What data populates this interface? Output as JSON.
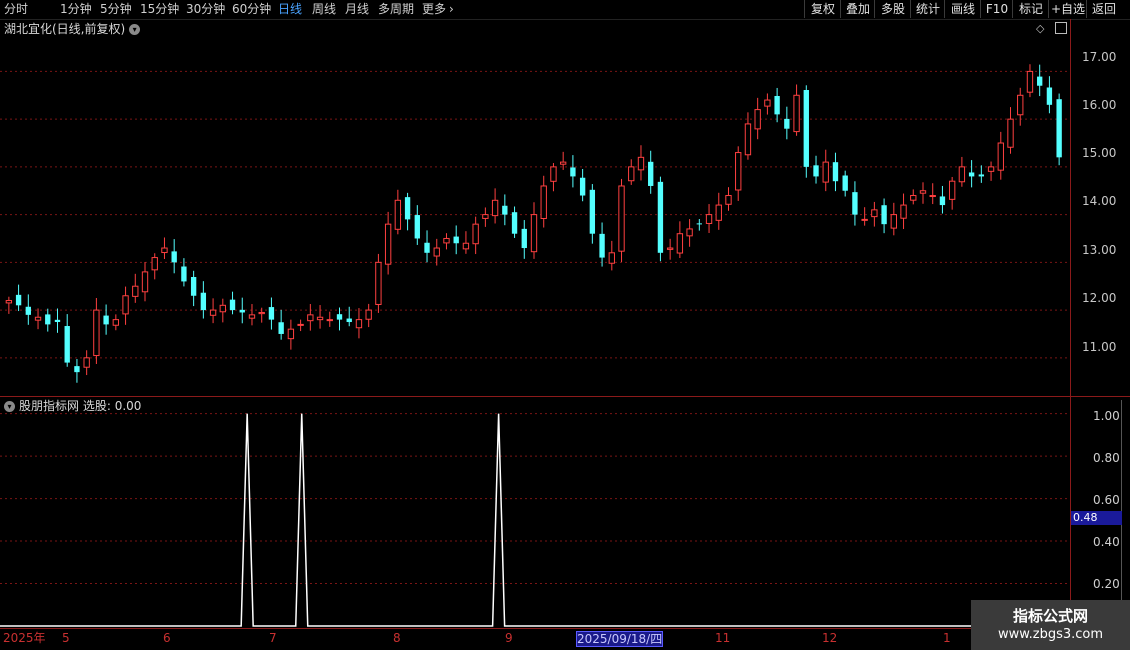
{
  "toolbar": {
    "periods": [
      "分时",
      "1分钟",
      "5分钟",
      "15分钟",
      "30分钟",
      "60分钟",
      "日线",
      "周线",
      "月线",
      "多周期",
      "更多"
    ],
    "active_period": "日线",
    "buttons": [
      "复权",
      "叠加",
      "多股",
      "统计",
      "画线",
      "F10",
      "标记",
      "+自选",
      "返回"
    ]
  },
  "main": {
    "title": "湖北宜化(日线,前复权)",
    "y_ticks": [
      "17.00",
      "16.00",
      "15.00",
      "14.00",
      "13.00",
      "12.00",
      "11.00"
    ]
  },
  "indicator": {
    "title": "股朋指标网",
    "label": "选股: 0.00",
    "y_ticks": [
      "1.00",
      "0.80",
      "0.60",
      "0.40",
      "0.20"
    ],
    "current_value": "0.48"
  },
  "x_axis": {
    "labels": [
      "2025年",
      "5",
      "6",
      "7",
      "8",
      "9",
      "2025/09/18/四",
      "11",
      "12",
      "1"
    ]
  },
  "watermark": {
    "line1": "指标公式网",
    "line2": "www.zbgs3.com"
  },
  "colors": {
    "up": "#ff4040",
    "down": "#54ffff",
    "grid": "#7a1515",
    "line": "#ffffff",
    "active": "#4aa3ff"
  },
  "chart_data": [
    {
      "type": "candlestick",
      "title": "湖北宜化(日线,前复权)",
      "ylim": [
        10.2,
        17.7
      ],
      "y_ticks": [
        11,
        12,
        13,
        14,
        15,
        16,
        17
      ],
      "x_labels": [
        "2025年",
        "5",
        "6",
        "7",
        "8",
        "9",
        "2025/09/18/四",
        "11",
        "12",
        "1"
      ],
      "approx_close_series": [
        12.2,
        12.1,
        11.9,
        11.85,
        11.7,
        11.75,
        10.9,
        10.7,
        11.0,
        12.0,
        11.7,
        11.8,
        12.3,
        12.5,
        12.8,
        13.1,
        13.3,
        13.0,
        12.6,
        12.3,
        12.0,
        12.0,
        12.1,
        12.0,
        11.95,
        11.9,
        11.95,
        11.8,
        11.5,
        11.6,
        11.7,
        11.9,
        11.85,
        11.8,
        11.8,
        11.75,
        11.8,
        12.0,
        13.0,
        13.8,
        14.3,
        13.9,
        13.5,
        13.2,
        13.3,
        13.5,
        13.4,
        13.4,
        13.8,
        14.0,
        14.3,
        14.0,
        13.6,
        13.3,
        14.0,
        14.6,
        15.0,
        15.1,
        14.8,
        14.4,
        13.6,
        13.1,
        13.2,
        14.6,
        15.0,
        15.2,
        14.6,
        13.2,
        13.3,
        13.6,
        13.7,
        13.8,
        14.0,
        14.2,
        14.4,
        15.3,
        15.9,
        16.2,
        16.4,
        16.1,
        15.8,
        16.5,
        15.0,
        14.8,
        15.1,
        14.7,
        14.5,
        14.0,
        13.9,
        14.1,
        13.8,
        14.0,
        14.2,
        14.4,
        14.5,
        14.4,
        14.2,
        14.7,
        15.0,
        14.8,
        14.8,
        15.0,
        15.5,
        16.0,
        16.5,
        17.0,
        16.7,
        16.3,
        15.2
      ],
      "extremes": {
        "high": 17.3,
        "low": 10.5
      }
    },
    {
      "type": "line",
      "title": "股朋指标网",
      "series": [
        {
          "name": "选股",
          "spikes_at_fraction": [
            0.231,
            0.282,
            0.466
          ],
          "spike_value": 1.0,
          "baseline": 0.0
        }
      ],
      "ylim": [
        0,
        1.05
      ],
      "y_ticks": [
        1.0,
        0.8,
        0.6,
        0.4,
        0.2
      ]
    }
  ]
}
